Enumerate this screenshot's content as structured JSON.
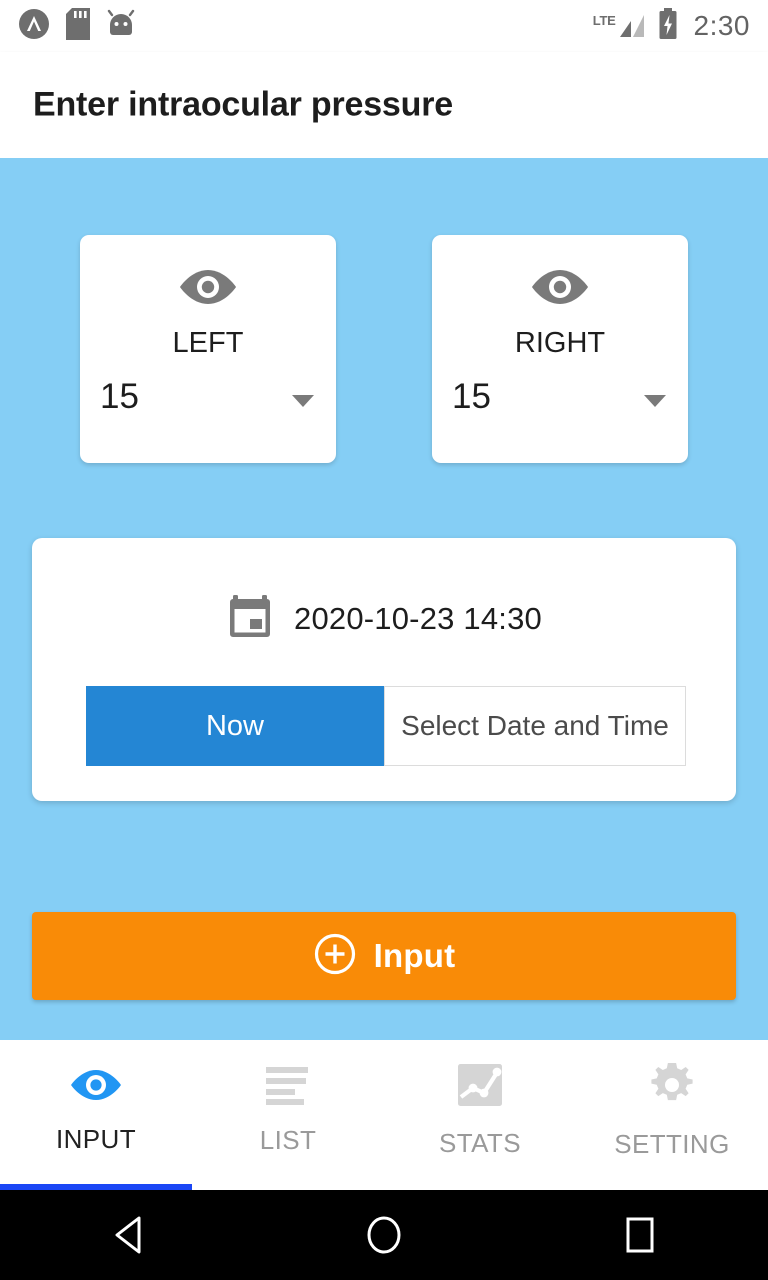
{
  "statusbar": {
    "time": "2:30",
    "network_label": "LTE",
    "icons": [
      "app-chevron-icon",
      "sd-card-icon",
      "android-head-icon",
      "lte-signal-icon",
      "battery-charging-icon"
    ]
  },
  "header": {
    "title": "Enter intraocular pressure"
  },
  "eyes": [
    {
      "key": "left",
      "label": "LEFT",
      "value": "15",
      "icon": "eye-icon"
    },
    {
      "key": "right",
      "label": "RIGHT",
      "value": "15",
      "icon": "eye-icon"
    }
  ],
  "datetime": {
    "icon": "calendar-icon",
    "value": "2020-10-23 14:30",
    "now_label": "Now",
    "select_label": "Select Date and Time"
  },
  "action": {
    "icon": "plus-circle-icon",
    "label": "Input"
  },
  "tabs": [
    {
      "label": "INPUT",
      "icon": "eye-icon",
      "active": true
    },
    {
      "label": "LIST",
      "icon": "list-icon",
      "active": false
    },
    {
      "label": "STATS",
      "icon": "chart-icon",
      "active": false
    },
    {
      "label": "SETTING",
      "icon": "gear-icon",
      "active": false
    }
  ],
  "navbar": {
    "back": "back-triangle-icon",
    "home": "home-circle-icon",
    "recents": "recents-square-icon"
  },
  "colors": {
    "background": "#85cef5",
    "accent_blue": "#2486d4",
    "accent_orange": "#f98b07",
    "tab_active": "#1a46f5",
    "icon_gray": "#7a7a7a"
  }
}
